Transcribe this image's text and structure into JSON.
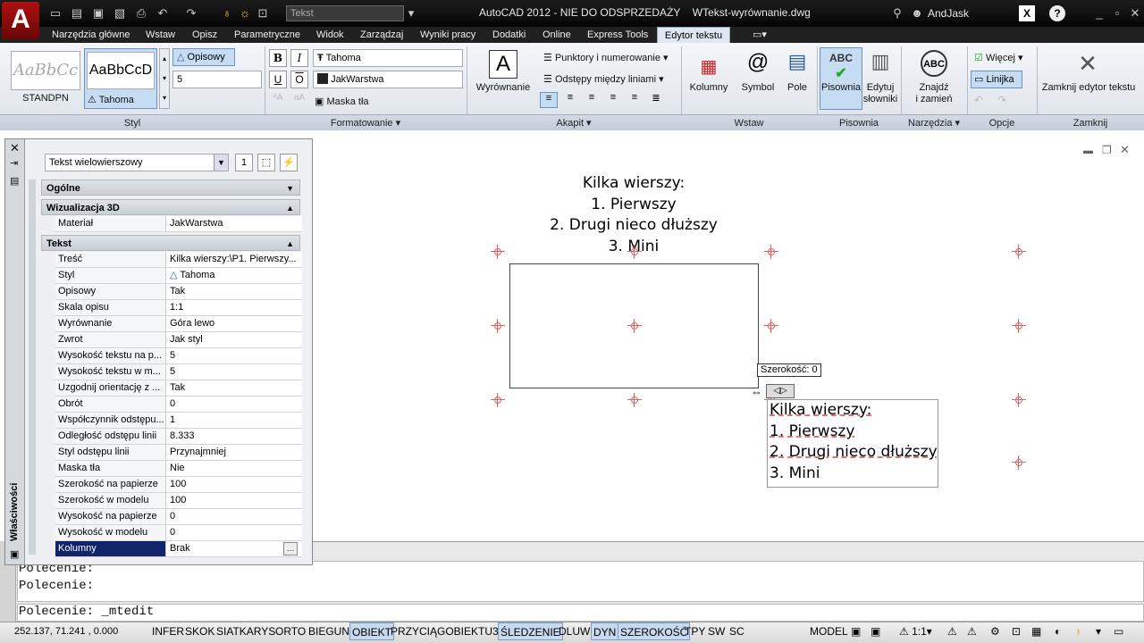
{
  "titlebar": {
    "title": "AutoCAD 2012 - NIE DO ODSPRZEDAŻY",
    "file": "WTekst-wyrównanie.dwg",
    "workspace": "Tekst",
    "user": "AndJask"
  },
  "tabs": [
    "Narzędzia główne",
    "Wstaw",
    "Opisz",
    "Parametryczne",
    "Widok",
    "Zarządzaj",
    "Wyniki pracy",
    "Dodatki",
    "Online",
    "Express Tools",
    "Edytor tekstu"
  ],
  "ribbon": {
    "styl": {
      "label": "Styl",
      "sample1": "AaBbCc",
      "sample1_name": "STANDPN",
      "sample2": "AaBbCcD",
      "sample2_name": "Tahoma",
      "opisowy": "Opisowy",
      "height": "5"
    },
    "formatowanie": {
      "label": "Formatowanie",
      "font": "Tahoma",
      "color": "JakWarstwa",
      "mask": "Maska tła"
    },
    "akapit": {
      "label": "Akapit",
      "align": "Wyrównanie",
      "bullets": "Punktory i numerowanie",
      "spacing": "Odstępy między liniami"
    },
    "wstaw": {
      "label": "Wstaw",
      "kolumny": "Kolumny",
      "symbol": "Symbol",
      "pole": "Pole"
    },
    "pisownia": {
      "label": "Pisownia",
      "check": "Pisownia",
      "edit": "Edytuj",
      "edit2": "słowniki"
    },
    "narzedzia": {
      "label": "Narzędzia",
      "find": "Znajdź",
      "find2": "i zamień"
    },
    "opcje": {
      "label": "Opcje",
      "more": "Więcej",
      "ruler": "Linijka"
    },
    "zamknij": {
      "label": "Zamknij",
      "close": "Zamknij edytor tekstu"
    }
  },
  "properties": {
    "panel_title": "Właściwości",
    "object_type": "Tekst wielowierszowy",
    "sections": {
      "ogolne": "Ogólne",
      "wiz3d": "Wizualizacja 3D",
      "tekst": "Tekst"
    },
    "material": {
      "key": "Materiał",
      "value": "JakWarstwa"
    },
    "rows": [
      {
        "key": "Treść",
        "value": "Kilka wierszy:\\P1. Pierwszy..."
      },
      {
        "key": "Styl",
        "value": "Tahoma"
      },
      {
        "key": "Opisowy",
        "value": "Tak"
      },
      {
        "key": "Skala opisu",
        "value": "1:1"
      },
      {
        "key": "Wyrównanie",
        "value": "Góra lewo"
      },
      {
        "key": "Zwrot",
        "value": "Jak styl"
      },
      {
        "key": "Wysokość tekstu na p...",
        "value": "5"
      },
      {
        "key": "Wysokość tekstu w m...",
        "value": "5"
      },
      {
        "key": "Uzgodnij orientację z ...",
        "value": "Tak"
      },
      {
        "key": "Obrót",
        "value": "0"
      },
      {
        "key": "Współczynnik odstępu...",
        "value": "1"
      },
      {
        "key": "Odległość odstępu linii",
        "value": "8.333"
      },
      {
        "key": "Styl odstępu linii",
        "value": "Przynajmniej"
      },
      {
        "key": "Maska tła",
        "value": "Nie"
      },
      {
        "key": "Szerokość na papierze",
        "value": "100"
      },
      {
        "key": "Szerokość w modelu",
        "value": "100"
      },
      {
        "key": "Wysokość na papierze",
        "value": "0"
      },
      {
        "key": "Wysokość w modelu",
        "value": "0"
      },
      {
        "key": "Kolumny",
        "value": "Brak"
      }
    ]
  },
  "drawing": {
    "text_top": [
      "Kilka wierszy:",
      "1. Pierwszy",
      "2. Drugi nieco dłuższy",
      "3. Mini"
    ],
    "text_edit": [
      "Kilka wierszy:",
      "1. Pierwszy",
      "2. Drugi nieco dłuższy",
      "3. Mini"
    ],
    "width_tooltip": "Szerokość: 0"
  },
  "command": {
    "line1": "Polecenie:",
    "line2": "Polecenie:",
    "prompt": "Polecenie: _mtedit"
  },
  "status": {
    "coords": "252.137, 71.241 , 0.000",
    "buttons": [
      "INFER",
      "SKOK",
      "SIATKARYS",
      "ORTO",
      "BIEGUN",
      "OBIEKT",
      "PRZYCIĄGOBIEKTU3D",
      "ŚLEDZENIE",
      "DLUW",
      "DYN",
      "SZEROKOŚĆ",
      "TPY",
      "SW",
      "SC"
    ],
    "model": "MODEL",
    "scale": "1:1"
  }
}
